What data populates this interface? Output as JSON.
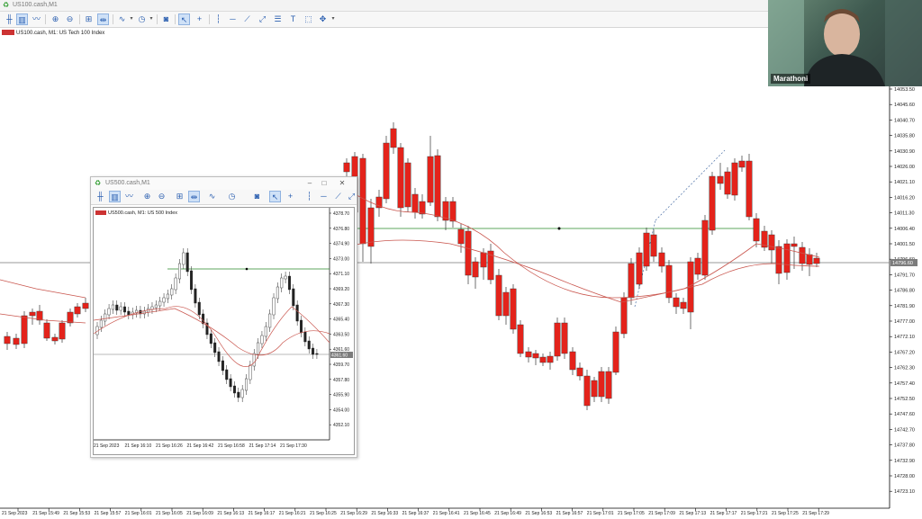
{
  "window": {
    "title": "US100.cash,M1"
  },
  "chart": {
    "label": "US100.cash, M1:  US Tech 100 Index",
    "price_labels": [
      "14053.50",
      "14045.60",
      "14040.70",
      "14035.80",
      "14030.90",
      "14026.00",
      "14021.10",
      "14016.20",
      "14011.30",
      "14006.40",
      "14001.50",
      "14796.60",
      "14791.70",
      "14786.80",
      "14781.90",
      "14777.00",
      "14772.10",
      "14767.20",
      "14762.30",
      "14757.40",
      "14752.50",
      "14747.60",
      "14742.70",
      "14737.80",
      "14732.90",
      "14728.00",
      "14723.10"
    ],
    "current_price_tag": "14796.60",
    "time_labels": [
      "21 Sep 2023",
      "21 Sep 15:49",
      "21 Sep 15:53",
      "21 Sep 15:57",
      "21 Sep 16:01",
      "21 Sep 16:05",
      "21 Sep 16:09",
      "21 Sep 16:13",
      "21 Sep 16:17",
      "21 Sep 16:21",
      "21 Sep 16:25",
      "21 Sep 16:29",
      "21 Sep 16:33",
      "21 Sep 16:37",
      "21 Sep 16:41",
      "21 Sep 16:45",
      "21 Sep 16:49",
      "21 Sep 16:53",
      "21 Sep 16:57",
      "21 Sep 17:01",
      "21 Sep 17:05",
      "21 Sep 17:09",
      "21 Sep 17:13",
      "21 Sep 17:17",
      "21 Sep 17:21",
      "21 Sep 17:25",
      "21 Sep 17:29"
    ]
  },
  "subwindow": {
    "title": "US500.cash,M1",
    "label": "US500.cash, M1:  US 500 Index",
    "price_labels": [
      "4378.70",
      "4376.80",
      "4374.90",
      "4373.00",
      "4371.10",
      "4369.20",
      "4367.30",
      "4365.40",
      "4363.50",
      "4361.60",
      "4359.70",
      "4357.80",
      "4355.90",
      "4354.00",
      "4352.10"
    ],
    "current_price_tag": "4361.60",
    "time_labels": [
      "21 Sep 2023",
      "21 Sep 16:10",
      "21 Sep 16:26",
      "21 Sep 16:42",
      "21 Sep 16:58",
      "21 Sep 17:14",
      "21 Sep 17:30"
    ]
  },
  "webcam": {
    "name": "Marathoni"
  },
  "colors": {
    "bull": "#2e9e3e",
    "bear": "#e3231b",
    "ma": "#c9564e",
    "hline": "#2a8a2a",
    "grid": "#888888"
  },
  "toolbar_icons": [
    "bar-chart-icon",
    "candles-icon",
    "line-chart-icon",
    "zoom-in-icon",
    "zoom-out-icon",
    "tile-icon",
    "autoscroll-icon",
    "indicators-icon",
    "periods-icon",
    "screenshot-icon",
    "cursor-icon",
    "crosshair-icon",
    "vertical-line-icon",
    "horizontal-line-icon",
    "trendline-icon",
    "channel-icon",
    "fibonacci-icon",
    "text-icon",
    "shapes-icon"
  ]
}
